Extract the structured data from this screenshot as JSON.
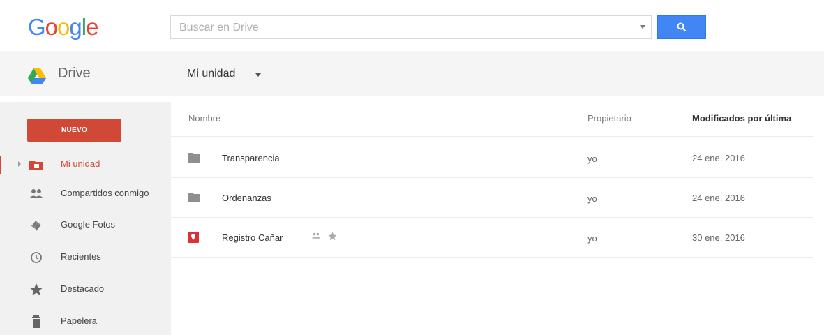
{
  "header": {
    "logo_text": "Google",
    "search_placeholder": "Buscar en Drive",
    "app_name": "Drive",
    "breadcrumb": "Mi unidad"
  },
  "sidebar": {
    "new_label": "NUEVO",
    "items": [
      {
        "label": "Mi unidad",
        "icon": "my-drive-icon",
        "active": true
      },
      {
        "label": "Compartidos conmigo",
        "icon": "shared-people-icon"
      },
      {
        "label": "Google Fotos",
        "icon": "google-photos-icon"
      },
      {
        "label": "Recientes",
        "icon": "clock-icon"
      },
      {
        "label": "Destacado",
        "icon": "star-icon"
      },
      {
        "label": "Papelera",
        "icon": "trash-icon"
      }
    ]
  },
  "table": {
    "columns": {
      "name": "Nombre",
      "owner": "Propietario",
      "modified": "Modificados por última"
    },
    "rows": [
      {
        "name": "Transparencia",
        "type": "folder-icon",
        "owner": "yo",
        "modified": "24 ene. 2016"
      },
      {
        "name": "Ordenanzas",
        "type": "folder-icon",
        "owner": "yo",
        "modified": "24 ene. 2016"
      },
      {
        "name": "Registro Cañar",
        "type": "map-file-icon",
        "owner": "yo",
        "modified": "30 ene. 2016",
        "shared": true,
        "starred": true
      }
    ]
  },
  "colors": {
    "accent_red": "#d14836",
    "search_blue": "#4285f4"
  }
}
